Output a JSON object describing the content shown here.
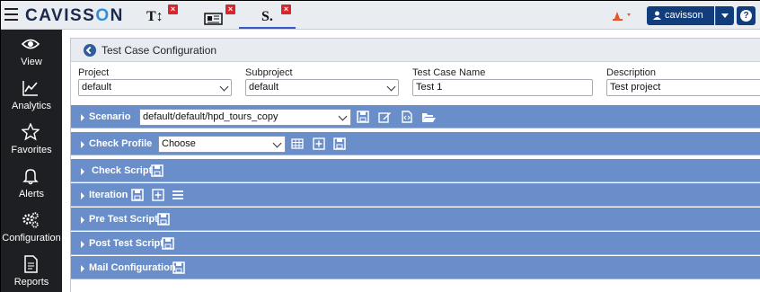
{
  "brand": {
    "name_left": "CAVISS",
    "name_o": "O",
    "name_right": "N"
  },
  "tabs": [
    {
      "glyph": "T↕",
      "icon": "text-tool-icon",
      "close": "×"
    },
    {
      "glyph": "📰",
      "icon": "news-icon",
      "close": "×"
    },
    {
      "glyph": "S.",
      "icon": "script-icon",
      "close": "×"
    }
  ],
  "user": {
    "name": "cavisson",
    "help": "?"
  },
  "sidebar": [
    {
      "label": "View",
      "icon": "eye-icon"
    },
    {
      "label": "Analytics",
      "icon": "analytics-icon"
    },
    {
      "label": "Favorites",
      "icon": "star-icon"
    },
    {
      "label": "Alerts",
      "icon": "bell-icon"
    },
    {
      "label": "Configuration",
      "icon": "gears-icon"
    },
    {
      "label": "Reports",
      "icon": "report-icon"
    }
  ],
  "panel": {
    "title": "Test Case Configuration",
    "fields": [
      {
        "label": "Project",
        "value": "default"
      },
      {
        "label": "Subproject",
        "value": "default"
      },
      {
        "label": "Test Case Name",
        "value": "Test 1"
      },
      {
        "label": "Description",
        "value": "Test project"
      }
    ],
    "sections": [
      {
        "title": "Scenario",
        "input": "default/default/hpd_tours_copy"
      },
      {
        "title": "Check Profile",
        "input": "Choose"
      },
      {
        "title": "Check Script"
      },
      {
        "title": "Iteration"
      },
      {
        "title": "Pre Test Script"
      },
      {
        "title": "Post Test Script"
      },
      {
        "title": "Mail Configuration"
      }
    ]
  },
  "colors": {
    "section_bg": "#6a8ec9",
    "sidebar_bg": "#1e1f22",
    "accent": "#123d7c",
    "close": "#d9262c"
  }
}
